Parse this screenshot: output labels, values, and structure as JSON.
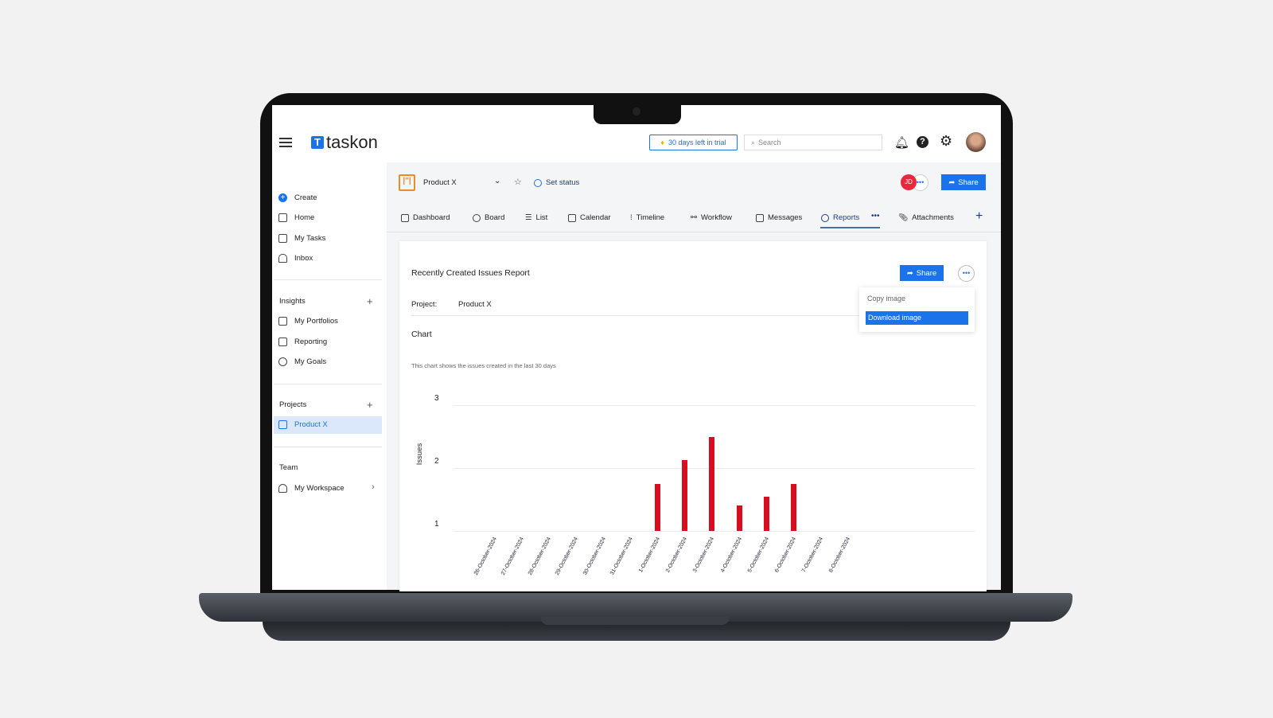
{
  "header": {
    "logo": "taskon",
    "trial": "30 days left in trial",
    "search_placeholder": "Search"
  },
  "sidebar": {
    "items": [
      {
        "label": "Create",
        "icon": "plus-circle-icon"
      },
      {
        "label": "Home",
        "icon": "home-icon"
      },
      {
        "label": "My Tasks",
        "icon": "clipboard-icon"
      },
      {
        "label": "Inbox",
        "icon": "bell-icon"
      }
    ],
    "insights": {
      "title": "Insights",
      "items": [
        {
          "label": "My Portfolios",
          "icon": "folder-icon"
        },
        {
          "label": "Reporting",
          "icon": "bar-chart-icon"
        },
        {
          "label": "My Goals",
          "icon": "target-icon"
        }
      ]
    },
    "projects": {
      "title": "Projects",
      "items": [
        {
          "label": "Product X",
          "icon": "board-icon",
          "active": true
        }
      ]
    },
    "team": {
      "title": "Team",
      "items": [
        {
          "label": "My Workspace",
          "icon": "people-icon"
        }
      ]
    }
  },
  "project": {
    "name": "Product X",
    "set_status": "Set status",
    "avatar": "JD",
    "share": "Share"
  },
  "tabs": [
    {
      "label": "Dashboard"
    },
    {
      "label": "Board"
    },
    {
      "label": "List"
    },
    {
      "label": "Calendar"
    },
    {
      "label": "Timeline"
    },
    {
      "label": "Workflow"
    },
    {
      "label": "Messages"
    },
    {
      "label": "Reports",
      "active": true
    },
    {
      "label": "Attachments"
    }
  ],
  "report": {
    "title": "Recently Created Issues Report",
    "share": "Share",
    "project_label": "Project:",
    "project_value": "Product X",
    "chart_heading": "Chart",
    "description": "This chart shows the issues created in the last 30 days",
    "menu": {
      "copy": "Copy image",
      "download": "Download image"
    }
  },
  "chart_data": {
    "type": "bar",
    "ylabel": "Issues",
    "ylim": [
      1,
      3
    ],
    "yticks": [
      "1",
      "2",
      "3"
    ],
    "color": "#d90d1f",
    "grid": true,
    "categories": [
      "26-October-2024",
      "27-October-2024",
      "28-October-2024",
      "29-October-2024",
      "30-October-2024",
      "31-October-2024",
      "1-October-2024",
      "2-October-2024",
      "3-October-2024",
      "4-October-2024",
      "5-October-2024",
      "6-October-2024",
      "7-October-2024",
      "8-October-2024"
    ],
    "values": [
      null,
      null,
      null,
      null,
      null,
      null,
      1.75,
      2.13,
      2.5,
      1.4,
      1.55,
      1.75,
      null,
      null
    ]
  },
  "colors": {
    "accent": "#1a73e8",
    "bar": "#d90d1f"
  }
}
